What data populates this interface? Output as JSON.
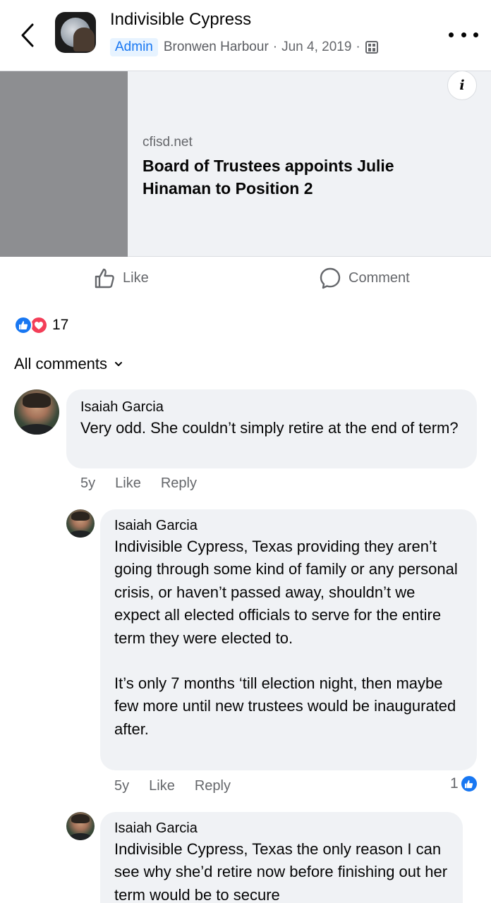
{
  "header": {
    "group_name": "Indivisible Cypress",
    "badge": "Admin",
    "author": "Bronwen Harbour",
    "date": "Jun 4, 2019",
    "separator": "·"
  },
  "link_card": {
    "domain": "cfisd.net",
    "title": "Board of Trustees appoints Julie Hinaman to Position 2",
    "info_label": "i"
  },
  "actions": {
    "like_label": "Like",
    "comment_label": "Comment"
  },
  "reactions": {
    "count": "17"
  },
  "comments_sort": {
    "label": "All comments"
  },
  "comments": [
    {
      "author": "Isaiah Garcia",
      "text": "Very odd. She couldn’t simply retire at the end of term?",
      "age": "5y",
      "like_label": "Like",
      "reply_label": "Reply"
    },
    {
      "author": "Isaiah Garcia",
      "text_p1": "Indivisible Cypress, Texas providing they aren’t going through some kind of family or any personal crisis, or haven’t passed away, shouldn’t we expect all elected officials to serve for the entire term they were elected to.",
      "text_p2": "It’s only 7 months ‘till election night, then maybe few more until new trustees would be inaugurated after.",
      "age": "5y",
      "like_label": "Like",
      "reply_label": "Reply",
      "likes": "1"
    },
    {
      "author": "Isaiah Garcia",
      "text": "Indivisible Cypress, Texas the only reason I can see why she’d retire now before finishing out her term would be to secure"
    }
  ],
  "colors": {
    "accent": "#1877f2",
    "love": "#f33e58",
    "bubble": "#f0f2f5",
    "meta_text": "#65676b"
  }
}
